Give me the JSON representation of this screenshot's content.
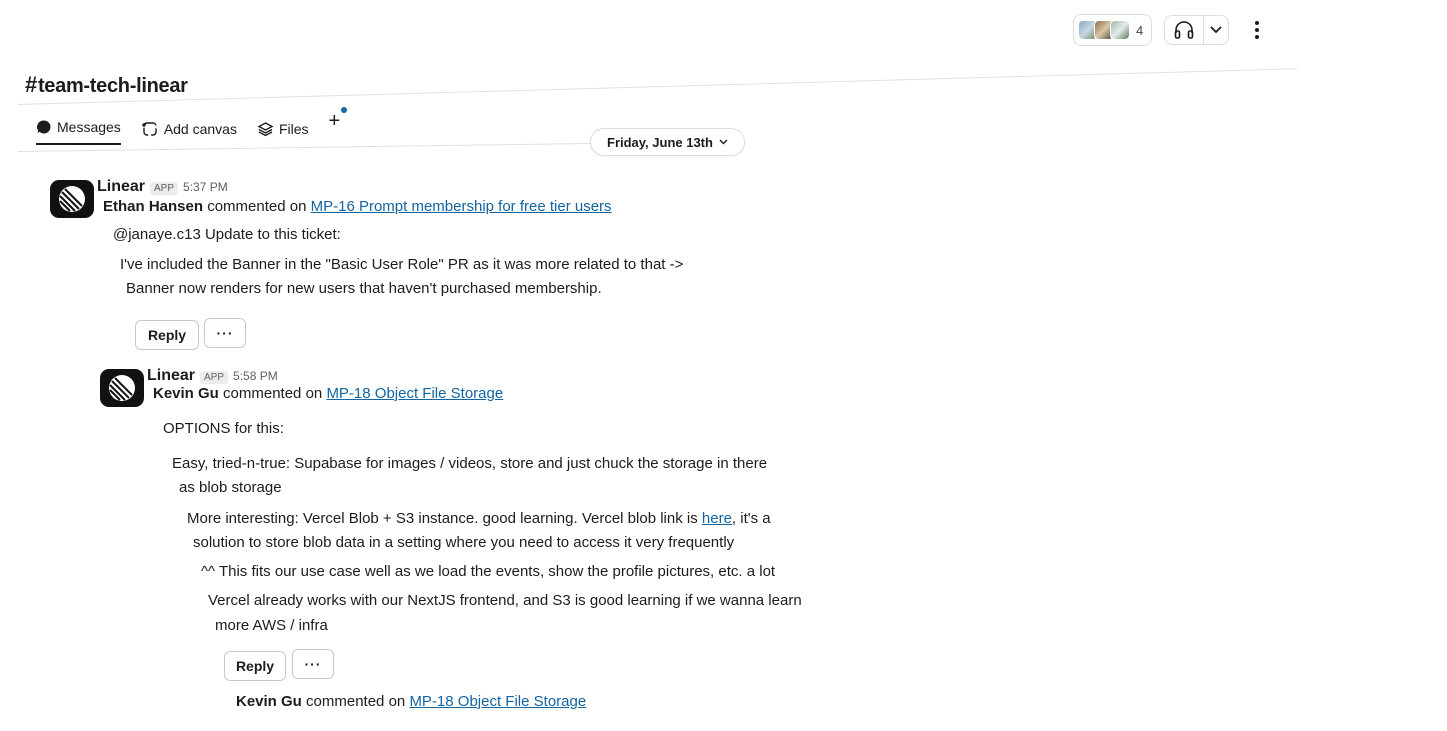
{
  "header": {
    "channel_name": "team-tech-linear",
    "member_count": "4"
  },
  "tabs": [
    {
      "label": "Messages"
    },
    {
      "label": "Add canvas"
    },
    {
      "label": "Files"
    }
  ],
  "date_divider": "Friday, June 13th",
  "messages": [
    {
      "sender": "Linear",
      "badge": "APP",
      "time": "5:37 PM",
      "author": "Ethan Hansen",
      "action": "commented on",
      "issue_link": "MP-16 Prompt membership for free tier users",
      "body": [
        "@janaye.c13 Update to this ticket:",
        "I've included the Banner in the \"Basic User Role\" PR as it was more related to that ->",
        "Banner now renders for new users that haven't purchased membership."
      ],
      "reply_label": "Reply",
      "more_label": "···"
    },
    {
      "sender": "Linear",
      "badge": "APP",
      "time": "5:58 PM",
      "author": "Kevin Gu",
      "action": "commented on",
      "issue_link": "MP-18 Object File Storage",
      "body": [
        "OPTIONS for this:",
        "Easy, tried-n-true: Supabase for images / videos, store and just chuck the storage in there",
        "as blob storage",
        "More interesting: Vercel Blob + S3 instance. good learning. Vercel blob link is ",
        "here",
        ", it's a",
        "solution to store blob data in a setting where you need to access it very frequently",
        "^^ This fits our use case well as we load the events, show the profile pictures, etc. a lot",
        "Vercel already works with our NextJS frontend, and S3 is good learning if we wanna learn",
        "more AWS / infra"
      ],
      "reply_label": "Reply",
      "more_label": "···"
    },
    {
      "author": "Kevin Gu",
      "action": "commented on",
      "issue_link": "MP-18 Object File Storage"
    }
  ]
}
